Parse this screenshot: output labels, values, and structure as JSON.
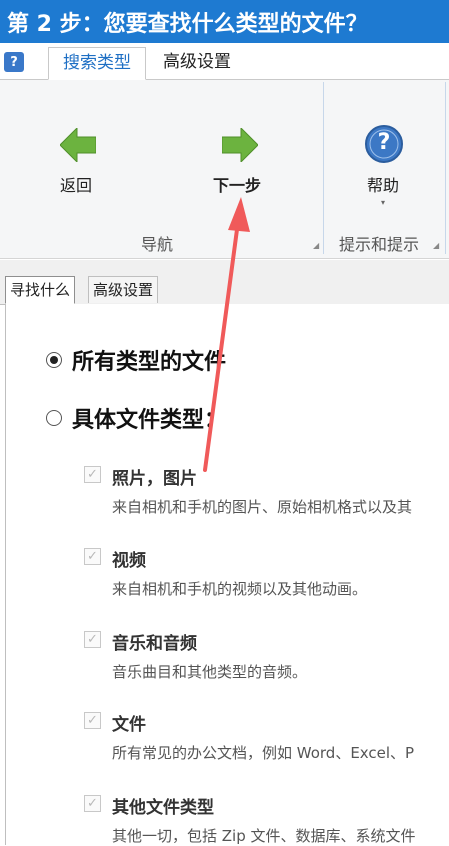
{
  "window": {
    "title": "第 2 步：您要查找什么类型的文件？"
  },
  "ribbon_tabs": {
    "help_icon_text": "?",
    "active": "搜索类型",
    "inactive": "高级设置"
  },
  "ribbon": {
    "back_label": "返回",
    "next_label": "下一步",
    "help_label": "帮助",
    "help_icon_text": "?",
    "group_nav": "导航",
    "group_tips": "提示和提示",
    "colors": {
      "arrow_green": "#6cb33f",
      "help_blue": "#3c78c5",
      "annotation_red": "#f05a5a"
    }
  },
  "inner_tabs": {
    "active": "寻找什么",
    "inactive": "高级设置"
  },
  "options": {
    "all_types": {
      "label": "所有类型的文件",
      "checked": true
    },
    "specific_types": {
      "label": "具体文件类型：",
      "checked": false
    }
  },
  "checkbox_items": [
    {
      "title": "照片，图片",
      "desc": "来自相机和手机的图片、原始相机格式以及其",
      "checked": true
    },
    {
      "title": "视频",
      "desc": "来自相机和手机的视频以及其他动画。",
      "checked": true
    },
    {
      "title": "音乐和音频",
      "desc": "音乐曲目和其他类型的音频。",
      "checked": true
    },
    {
      "title": "文件",
      "desc": "所有常见的办公文档，例如 Word、Excel、P",
      "checked": true
    },
    {
      "title": "其他文件类型",
      "desc": "其他一切，包括 Zip 文件、数据库、系统文件",
      "checked": true
    }
  ]
}
